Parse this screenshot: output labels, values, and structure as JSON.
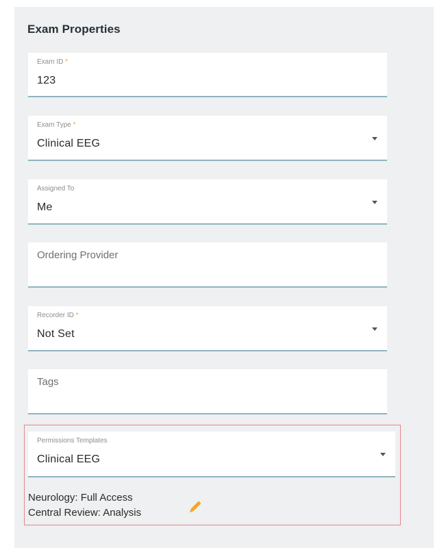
{
  "panel": {
    "title": "Exam Properties"
  },
  "fields": {
    "exam_id": {
      "label": "Exam ID",
      "required_mark": "*",
      "value": "123"
    },
    "exam_type": {
      "label": "Exam Type",
      "required_mark": "*",
      "value": "Clinical EEG",
      "icon": "chevron-down-icon"
    },
    "assigned_to": {
      "label": "Assigned To",
      "value": "Me",
      "icon": "chevron-down-icon"
    },
    "ordering_provider": {
      "placeholder": "Ordering Provider"
    },
    "recorder_id": {
      "label": "Recorder ID",
      "required_mark": "*",
      "value": "Not Set",
      "icon": "chevron-down-icon"
    },
    "tags": {
      "placeholder": "Tags"
    },
    "permissions_templates": {
      "label": "Permissions Templates",
      "value": "Clinical EEG",
      "icon": "chevron-down-icon"
    }
  },
  "permissions": {
    "lines": [
      "Neurology: Full Access",
      "Central Review: Analysis"
    ],
    "edit_icon": "pencil-icon"
  },
  "colors": {
    "panel_bg": "#eef0f1",
    "field_underline": "#8fb3bf",
    "required_mark": "#f5a623",
    "highlight_border": "#e3868b",
    "edit_icon": "#f5a623"
  }
}
